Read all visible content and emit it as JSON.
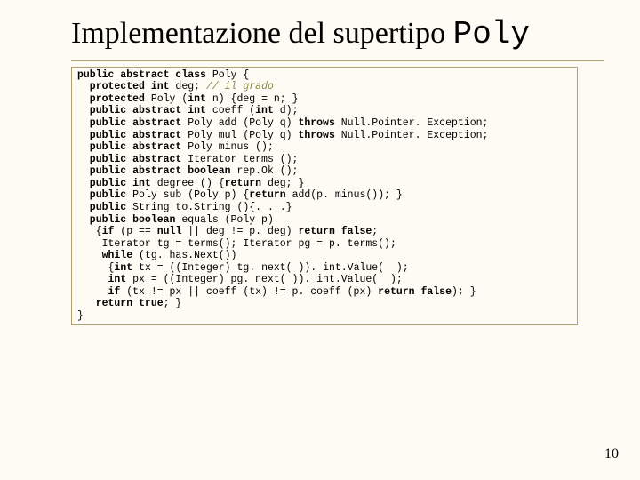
{
  "title_text": "Implementazione del supertipo ",
  "title_code": "Poly",
  "code": {
    "l01a": "public abstract class",
    "l01b": " Poly {",
    "l02a": "  protected int",
    "l02b": " deg; ",
    "l02c": "// il grado",
    "l03a": "  protected",
    "l03b": " Poly (",
    "l03c": "int",
    "l03d": " n) {deg = n; }",
    "l04a": "  public abstract int",
    "l04b": " coeff (",
    "l04c": "int",
    "l04d": " d);",
    "l05a": "  public abstract",
    "l05b": " Poly add (Poly q) ",
    "l05c": "throws",
    "l05d": " Null.Pointer. Exception;",
    "l06a": "  public abstract",
    "l06b": " Poly mul (Poly q) ",
    "l06c": "throws",
    "l06d": " Null.Pointer. Exception;",
    "l07a": "  public abstract",
    "l07b": " Poly minus ();",
    "l08a": "  public abstract",
    "l08b": " Iterator terms ();",
    "l09a": "  public abstract boolean",
    "l09b": " rep.Ok ();",
    "l10a": "  public int",
    "l10b": " degree () {",
    "l10c": "return",
    "l10d": " deg; }",
    "l11a": "  public",
    "l11b": " Poly sub (Poly p) {",
    "l11c": "return",
    "l11d": " add(p. minus()); }",
    "l12a": "  public",
    "l12b": " String to.String (){. . .}",
    "l13a": "  public boolean",
    "l13b": " equals (Poly p)",
    "l14a": "   {",
    "l14b": "if",
    "l14c": " (p == ",
    "l14d": "null",
    "l14e": " || deg != p. deg) ",
    "l14f": "return false",
    "l14g": ";",
    "l15": "    Iterator tg = terms(); Iterator pg = p. terms();",
    "l16a": "    while",
    "l16b": " (tg. has.Next())",
    "l17a": "     {",
    "l17b": "int",
    "l17c": " tx = ((Integer) tg. next( )). int.Value(  );",
    "l18a": "     int",
    "l18b": " px = ((Integer) pg. next( )). int.Value(  );",
    "l19a": "     if",
    "l19b": " (tx != px || coeff (tx) != p. coeff (px) ",
    "l19c": "return false",
    "l19d": "); }",
    "l20a": "   return true",
    "l20b": "; }",
    "l21": "}"
  },
  "page_number": "10"
}
